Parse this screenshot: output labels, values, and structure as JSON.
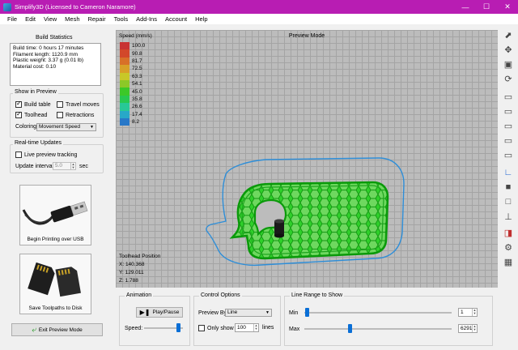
{
  "window": {
    "title": "Simplify3D (Licensed to Cameron Naramore)"
  },
  "menu": [
    "File",
    "Edit",
    "View",
    "Mesh",
    "Repair",
    "Tools",
    "Add-Ins",
    "Account",
    "Help"
  ],
  "build_stats": {
    "title": "Build Statistics",
    "lines": [
      "Build time: 0 hours 17 minutes",
      "Filament length: 1120.9 mm",
      "Plastic weight: 3.37 g (0.01 lb)",
      "Material cost: 0.10"
    ]
  },
  "show_in_preview": {
    "title": "Show in Preview",
    "build_table": "Build table",
    "travel_moves": "Travel moves",
    "toolhead": "Toolhead",
    "retractions": "Retractions",
    "coloring_label": "Coloring",
    "coloring_value": "Movement Speed"
  },
  "realtime": {
    "title": "Real-time Updates",
    "live_tracking": "Live preview tracking",
    "interval_label": "Update interval",
    "interval_value": "5.0",
    "interval_unit": "sec"
  },
  "usb_button": "Begin Printing over USB",
  "disk_button": "Save Toolpaths to Disk",
  "exit_button": "Exit Preview Mode",
  "viewport": {
    "title": "Preview Mode",
    "legend_title": "Speed (mm/s)",
    "legend": [
      {
        "value": "100.0",
        "color": "#c83232"
      },
      {
        "value": "90.8",
        "color": "#d2482a"
      },
      {
        "value": "81.7",
        "color": "#d87028"
      },
      {
        "value": "72.5",
        "color": "#d8a028"
      },
      {
        "value": "63.3",
        "color": "#c8c828"
      },
      {
        "value": "54.1",
        "color": "#8cc828"
      },
      {
        "value": "45.0",
        "color": "#3cc828"
      },
      {
        "value": "35.8",
        "color": "#28c850"
      },
      {
        "value": "26.6",
        "color": "#28c896"
      },
      {
        "value": "17.4",
        "color": "#28a8c8"
      },
      {
        "value": "8.2",
        "color": "#2878c8"
      }
    ],
    "toolhead_title": "Toolhead Position",
    "x": "X: 140.368",
    "y": "Y: 129.011",
    "z": "Z: 1.788"
  },
  "animation": {
    "title": "Animation",
    "play_pause": "Play/Pause",
    "speed_label": "Speed:"
  },
  "control": {
    "title": "Control Options",
    "preview_by_label": "Preview By",
    "preview_by_value": "Line",
    "only_show": "Only show",
    "only_show_value": "100",
    "only_show_unit": "lines"
  },
  "range": {
    "title": "Line Range to Show",
    "min_label": "Min",
    "max_label": "Max",
    "min_value": "1",
    "max_value": "6291"
  }
}
